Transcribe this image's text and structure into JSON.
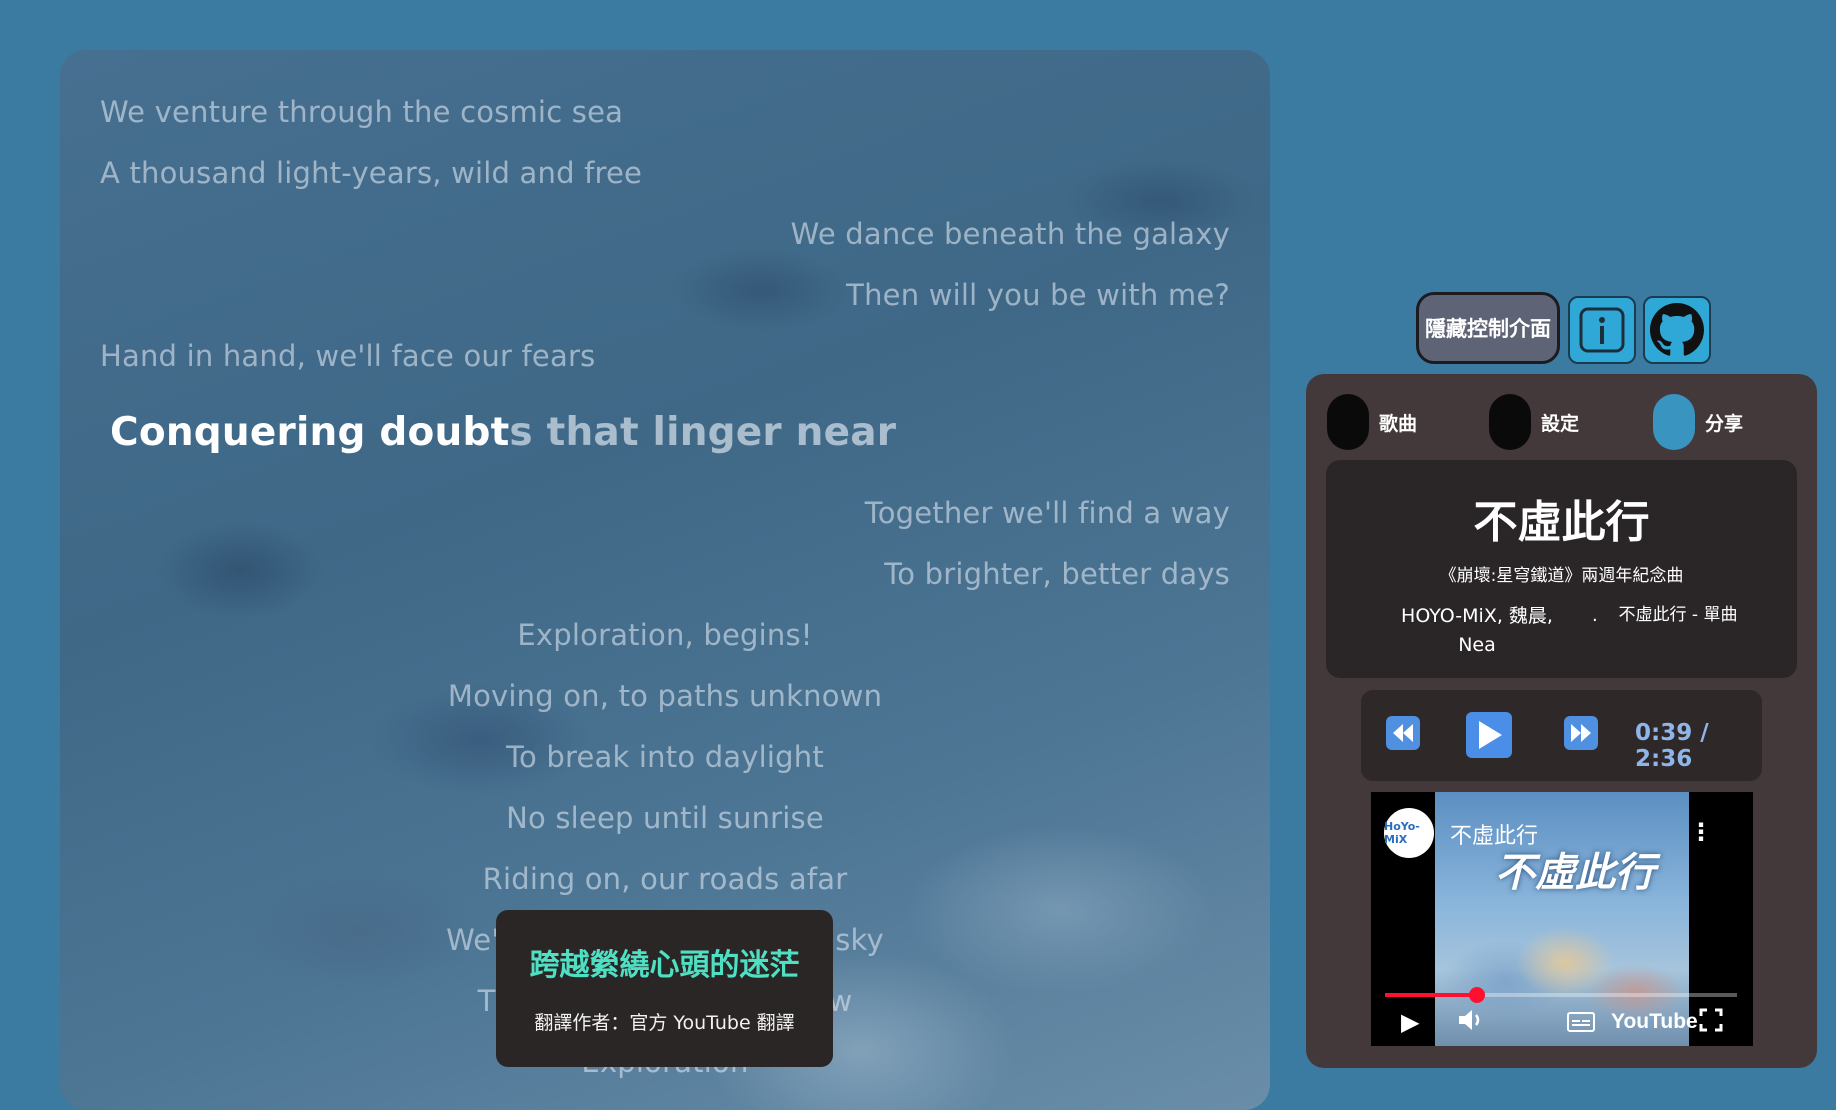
{
  "lyrics": {
    "lines": [
      "We venture through the cosmic sea",
      "A thousand light-years, wild and free",
      "We dance beneath the galaxy",
      "Then will you be with me?",
      "Hand in hand, we'll face our fears",
      "Together we'll find a way",
      "To brighter, better days",
      "Exploration, begins!",
      "Moving on, to paths unknown",
      "To break into daylight",
      "No sleep until sunrise",
      "Riding on, our roads afar",
      "We're rising high, into the sky",
      "There we go, till we know",
      "Exploration"
    ],
    "current_sung": "Conquering doubt",
    "current_rest": "s that linger near"
  },
  "translation": {
    "text": "跨越縈繞心頭的迷茫",
    "author": "翻譯作者：官方 YouTube 翻譯"
  },
  "toolbar": {
    "hide_label": "隱藏控制介面",
    "info_icon": "info-icon",
    "github_icon": "github-icon"
  },
  "tabs": {
    "songs": "歌曲",
    "settings": "設定",
    "share": "分享",
    "active": "share"
  },
  "song": {
    "title": "不虛此行",
    "subtitle": "《崩壞:星穹鐵道》兩週年紀念曲",
    "artists": "HOYO-MiX, 魏晨, Nea",
    "separator": "·",
    "album": "不虛此行 - 單曲"
  },
  "player": {
    "time": "0:39 / 2:36",
    "progress": 0.25
  },
  "video": {
    "channel_logo_text": "HoYo-MiX",
    "title": "不虛此行",
    "thumbnail_text": "不虛此行",
    "brand": "YouTube",
    "progress": 0.26
  },
  "colors": {
    "background": "#3b7aa1",
    "translation_text": "#4fe0c4",
    "accent_button": "#2fa8d8",
    "panel": "#44393a",
    "time_text": "#8fb6ea",
    "yt_progress": "#ff1030"
  }
}
